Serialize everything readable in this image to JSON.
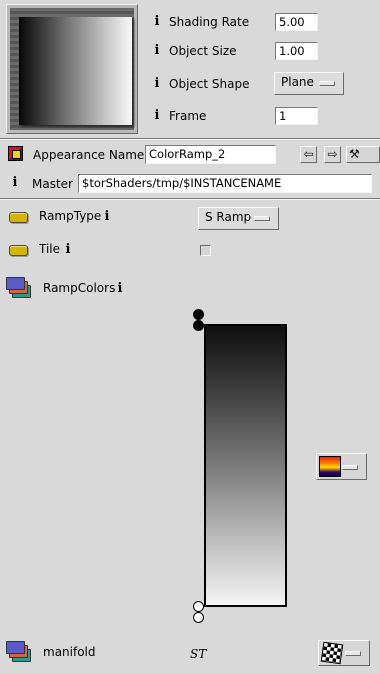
{
  "params": {
    "shading_rate": {
      "label": "Shading Rate",
      "value": "5.00"
    },
    "object_size": {
      "label": "Object Size",
      "value": "1.00"
    },
    "object_shape": {
      "label": "Object Shape",
      "value": "Plane"
    },
    "frame": {
      "label": "Frame",
      "value": "1"
    }
  },
  "appearance": {
    "label": "Appearance Name",
    "value": "ColorRamp_2"
  },
  "master": {
    "label": "Master",
    "value": "$torShaders/tmp/$INSTANCENAME"
  },
  "shader_params": {
    "ramp_type": {
      "label": "RampType",
      "value": "S Ramp"
    },
    "tile": {
      "label": "Tile",
      "checked": false
    },
    "ramp_colors": {
      "label": "RampColors"
    },
    "manifold": {
      "label": "manifold",
      "value": "ST"
    }
  },
  "icons": {
    "info": "info-icon",
    "arrow_left": "arrow-left-icon",
    "arrow_right": "arrow-right-icon",
    "tool": "hammer-icon"
  },
  "glyphs": {
    "info": "i",
    "arrow_left": "⇦",
    "arrow_right": "⇨",
    "tool": "⚒"
  },
  "colors": {
    "background": "#d9d9d9",
    "param_pill": "#d4b400",
    "stack_top": "#5b5bc8",
    "stack_mid": "#d8643c",
    "stack_bottom": "#2a9a8c"
  }
}
